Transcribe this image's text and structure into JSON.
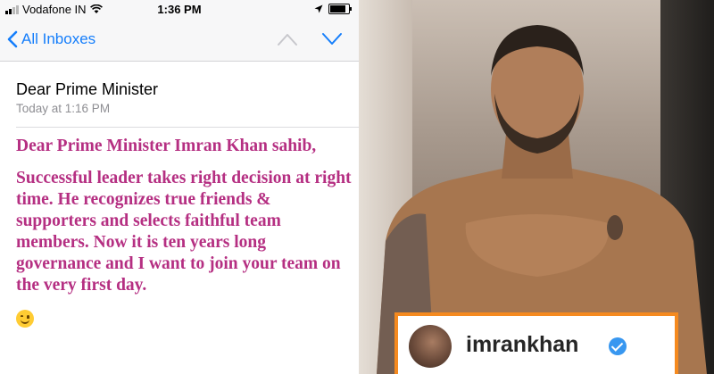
{
  "status_bar": {
    "carrier": "Vodafone IN",
    "time": "1:36 PM"
  },
  "nav": {
    "back_label": "All Inboxes"
  },
  "email": {
    "subject": "Dear Prime Minister",
    "date": "Today at 1:16 PM",
    "greeting": "Dear Prime Minister Imran Khan sahib,",
    "body": "Successful leader takes right decision at right time. He recognizes true friends & supporters and selects faithful team members. Now it is ten years long governance and I want to join your team on the very first day.",
    "text_color": "#b52f82"
  },
  "profile": {
    "username": "imrankhan",
    "highlight_color": "#f58a1f",
    "verified_color": "#3897f0"
  }
}
